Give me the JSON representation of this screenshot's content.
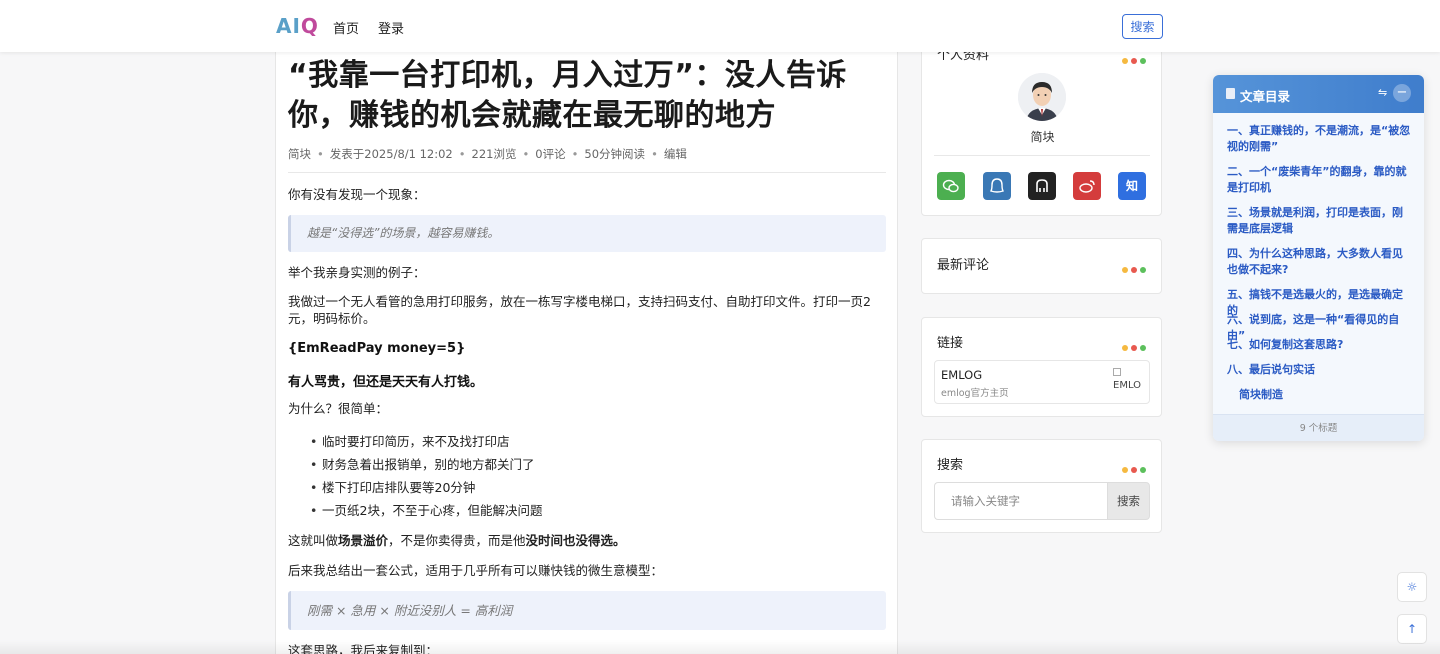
{
  "header": {
    "logo_text_a": "AI",
    "logo_text_b": "Q",
    "nav": [
      "首页",
      "登录"
    ],
    "search_button": "搜索"
  },
  "article": {
    "title": "“我靠一台打印机，月入过万”：没人告诉你，赚钱的机会就藏在最无聊的地方",
    "meta": {
      "author": "简块",
      "published": "发表于2025/8/1 12:02",
      "views": "221浏览",
      "comments": "0评论",
      "read_time": "50分钟阅读",
      "edit": "编辑"
    },
    "p1": "你有没有发现一个现象：",
    "quote1": "越是“没得选”的场景，越容易赚钱。",
    "p2": "举个我亲身实测的例子：",
    "p3": "我做过一个无人看管的急用打印服务，放在一栋写字楼电梯口，支持扫码支付、自助打印文件。打印一页2元，明码标价。",
    "shortcode": "{EmReadPay money=5}",
    "bold1": "有人骂贵，但还是天天有人打钱。",
    "p4": "为什么？很简单：",
    "bullets": [
      "临时要打印简历，来不及找打印店",
      "财务急着出报销单，别的地方都关门了",
      "楼下打印店排队要等20分钟",
      "一页纸2块，不至于心疼，但能解决问题"
    ],
    "p5_a": "这就叫做",
    "p5_b": "场景溢价",
    "p5_c": "，不是你卖得贵，而是他",
    "p5_d": "没时间也没得选。",
    "p6": "后来我总结出一套公式，适用于几乎所有可以赚快钱的微生意模型：",
    "quote2": "刚需 × 急用 × 附近没别人 = 高利润",
    "p7": "这套思路，我后来复制到："
  },
  "sidebar": {
    "profile": {
      "title": "个人资料",
      "name": "简块",
      "socials": [
        {
          "icon": "wechat-icon",
          "color": "#4caf50"
        },
        {
          "icon": "qq-icon",
          "color": "#3a78b5"
        },
        {
          "icon": "github-icon",
          "color": "#222222"
        },
        {
          "icon": "weibo-icon",
          "color": "#d43c3c"
        },
        {
          "icon": "zhihu-icon",
          "label": "知",
          "color": "#2f6fe0"
        }
      ]
    },
    "comments": {
      "title": "最新评论"
    },
    "links": {
      "title": "链接",
      "item_name": "EMLOG",
      "item_desc": "emlog官方主页",
      "item_img_alt": "EMLO"
    },
    "search": {
      "title": "搜索",
      "placeholder": "请输入关键字",
      "button": "搜索"
    },
    "dot_colors": [
      "#f5b940",
      "#e8594f",
      "#5cc05c"
    ]
  },
  "toc": {
    "title": "文章目录",
    "items": [
      "一、真正赚钱的，不是潮流，是“被忽视的刚需”",
      "二、一个“废柴青年”的翻身，靠的就是打印机",
      "三、场景就是利润，打印是表面，刚需是底层逻辑",
      "四、为什么这种思路，大多数人看见也做不起来?",
      "五、搞钱不是选最火的，是选最确定的",
      "六、说到底，这是一种“看得见的自由”",
      "七、如何复制这套思路?",
      "八、最后说句实话",
      "简块制造"
    ],
    "footer": "9 个标题"
  },
  "floating": {
    "theme_icon": "sun-icon",
    "top_icon": "arrow-up-icon"
  }
}
